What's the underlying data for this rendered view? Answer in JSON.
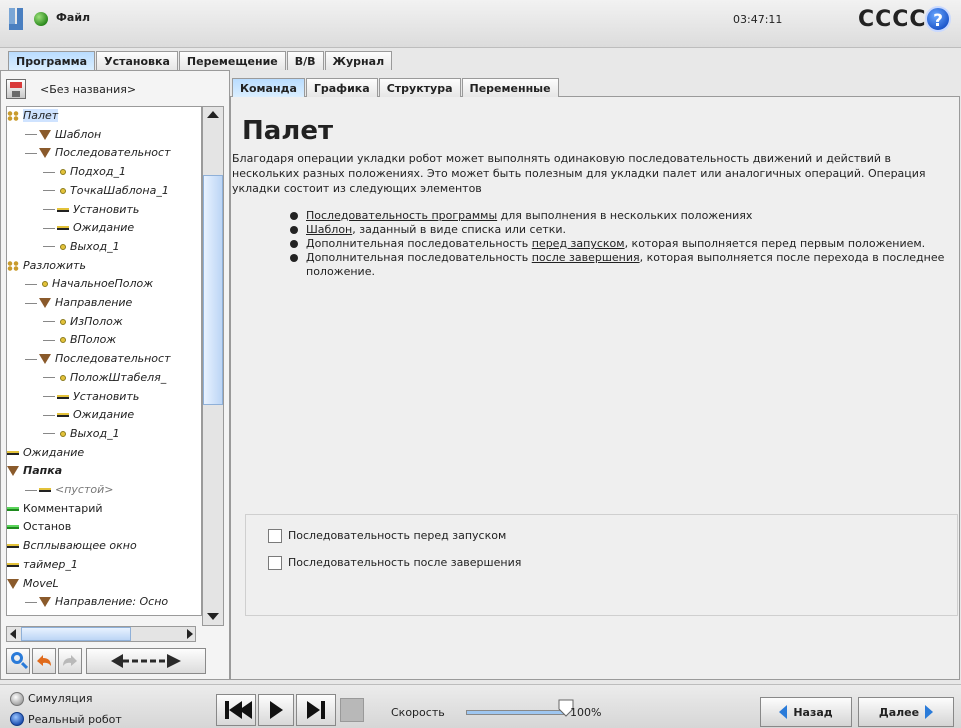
{
  "header": {
    "file_menu": "Файл",
    "clock": "03:47:11",
    "robot_name": "CCCC",
    "help_label": "?"
  },
  "main_tabs": [
    {
      "label": "Программа",
      "active": true
    },
    {
      "label": "Установка",
      "active": false
    },
    {
      "label": "Перемещение",
      "active": false
    },
    {
      "label": "В/В",
      "active": false
    },
    {
      "label": "Журнал",
      "active": false
    }
  ],
  "program": {
    "name": "<Без названия>"
  },
  "tree": [
    {
      "label": "Палет",
      "icon": "pallet-icon",
      "selected": true
    },
    {
      "label": "Шаблон",
      "icon": "folder-triangle-icon"
    },
    {
      "label": "Последовательност",
      "icon": "folder-triangle-icon"
    },
    {
      "label": "Подход_1",
      "icon": "waypoint-icon"
    },
    {
      "label": "ТочкаШаблона_1",
      "icon": "waypoint-icon"
    },
    {
      "label": "Установить",
      "icon": "set-icon"
    },
    {
      "label": "Ожидание",
      "icon": "wait-icon"
    },
    {
      "label": "Выход_1",
      "icon": "waypoint-icon"
    },
    {
      "label": "Разложить",
      "icon": "pallet-icon"
    },
    {
      "label": "НачальноеПолож",
      "icon": "waypoint-icon"
    },
    {
      "label": "Направление",
      "icon": "folder-triangle-icon"
    },
    {
      "label": "ИзПолож",
      "icon": "waypoint-icon"
    },
    {
      "label": "ВПолож",
      "icon": "waypoint-icon"
    },
    {
      "label": "Последовательност",
      "icon": "folder-triangle-icon"
    },
    {
      "label": "ПоложШтабеля_",
      "icon": "waypoint-icon"
    },
    {
      "label": "Установить",
      "icon": "set-icon"
    },
    {
      "label": "Ожидание",
      "icon": "wait-icon"
    },
    {
      "label": "Выход_1",
      "icon": "waypoint-icon"
    },
    {
      "label": "Ожидание",
      "icon": "wait-icon"
    },
    {
      "label": "Папка",
      "icon": "folder-triangle-icon"
    },
    {
      "label": "<пустой>",
      "icon": "empty-icon"
    },
    {
      "label": "Комментарий",
      "icon": "comment-icon"
    },
    {
      "label": "Останов",
      "icon": "halt-icon"
    },
    {
      "label": "Всплывающее окно",
      "icon": "popup-icon"
    },
    {
      "label": "таймер_1",
      "icon": "timer-icon"
    },
    {
      "label": "MoveL",
      "icon": "folder-triangle-icon"
    },
    {
      "label": "Направление: Осно",
      "icon": "folder-triangle-icon"
    }
  ],
  "sub_tabs": [
    {
      "label": "Команда",
      "active": true
    },
    {
      "label": "Графика",
      "active": false
    },
    {
      "label": "Структура",
      "active": false
    },
    {
      "label": "Переменные",
      "active": false
    }
  ],
  "content": {
    "title": "Палет",
    "intro": "Благодаря операции укладки робот может выполнять одинаковую последовательность движений и действий в нескольких разных положениях. Это может быть полезным для укладки палет или аналогичных операций. Операция укладки состоит из следующих элементов",
    "bullets": [
      {
        "link": "Последовательность программы",
        "before": "",
        "after": " для выполнения в нескольких положениях"
      },
      {
        "link": "Шаблон",
        "before": "",
        "after": ", заданный в виде списка или сетки."
      },
      {
        "link": "перед запуском",
        "before": "Дополнительная последовательность ",
        "after": ", которая выполняется перед первым положением."
      },
      {
        "link": "после завершения",
        "before": "Дополнительная последовательность ",
        "after": ", которая выполняется после перехода в последнее положение."
      }
    ],
    "checkbox_before": "Последовательность перед запуском",
    "checkbox_after": "Последовательность после завершения"
  },
  "bottom": {
    "simulation": "Симуляция",
    "real_robot": "Реальный робот",
    "speed_label": "Скорость",
    "speed_value": "100%",
    "speed_fraction": 1.0,
    "back": "Назад",
    "next": "Далее"
  },
  "colors": {
    "accent": "#2a7bd9",
    "active_tab": "#b9dcff",
    "status_ok": "#2c8a1e"
  }
}
